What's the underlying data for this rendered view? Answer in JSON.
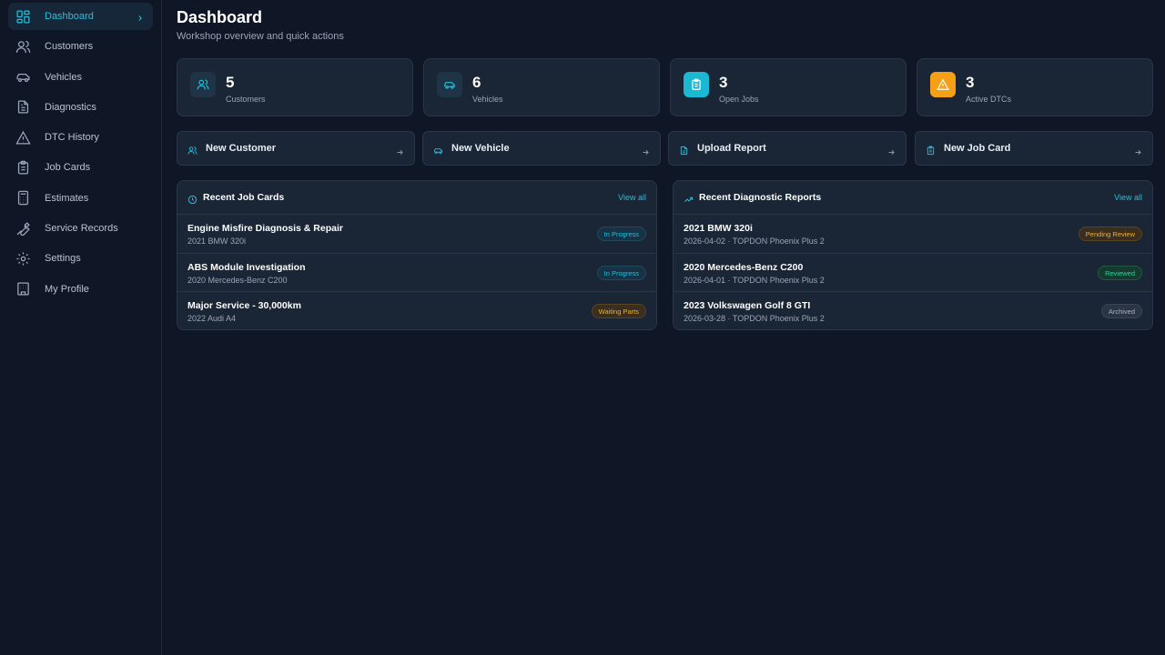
{
  "sidebar": {
    "items": [
      {
        "label": "Dashboard",
        "icon": "dashboard-icon",
        "active": true
      },
      {
        "label": "Customers",
        "icon": "users-icon"
      },
      {
        "label": "Vehicles",
        "icon": "car-icon"
      },
      {
        "label": "Diagnostics",
        "icon": "file-icon"
      },
      {
        "label": "DTC History",
        "icon": "warning-icon"
      },
      {
        "label": "Job Cards",
        "icon": "clipboard-icon"
      },
      {
        "label": "Estimates",
        "icon": "calculator-icon"
      },
      {
        "label": "Service Records",
        "icon": "wrench-icon"
      },
      {
        "label": "Settings",
        "icon": "gear-icon"
      },
      {
        "label": "My Profile",
        "icon": "building-icon"
      }
    ]
  },
  "header": {
    "title": "Dashboard",
    "subtitle": "Workshop overview and quick actions"
  },
  "stats": [
    {
      "value": "5",
      "label": "Customers",
      "icon": "users-icon"
    },
    {
      "value": "6",
      "label": "Vehicles",
      "icon": "car-icon"
    },
    {
      "value": "3",
      "label": "Open Jobs",
      "icon": "clipboard-icon"
    },
    {
      "value": "3",
      "label": "Active DTCs",
      "icon": "warning-icon"
    }
  ],
  "actions": [
    {
      "label": "New Customer",
      "icon": "user-plus-icon"
    },
    {
      "label": "New Vehicle",
      "icon": "car-icon"
    },
    {
      "label": "Upload Report",
      "icon": "file-icon"
    },
    {
      "label": "New Job Card",
      "icon": "clipboard-icon"
    }
  ],
  "job_cards": {
    "title": "Recent Job Cards",
    "link": "View all",
    "rows": [
      {
        "title": "Engine Misfire Diagnosis & Repair",
        "sub": "2021 BMW 320i",
        "status": "In Progress"
      },
      {
        "title": "ABS Module Investigation",
        "sub": "2020 Mercedes-Benz C200",
        "status": "In Progress"
      },
      {
        "title": "Major Service - 30,000km",
        "sub": "2022 Audi A4",
        "status": "Waiting Parts"
      }
    ]
  },
  "reports": {
    "title": "Recent Diagnostic Reports",
    "link": "View all",
    "rows": [
      {
        "title": "2021 BMW 320i",
        "sub": "2026-04-02 · TOPDON Phoenix Plus 2",
        "status": "Pending Review"
      },
      {
        "title": "2020 Mercedes-Benz C200",
        "sub": "2026-04-01 · TOPDON Phoenix Plus 2",
        "status": "Reviewed"
      },
      {
        "title": "2023 Volkswagen Golf 8 GTI",
        "sub": "2026-03-28 · TOPDON Phoenix Plus 2",
        "status": "Archived"
      }
    ]
  },
  "colors": {
    "accent": "#22c1dc",
    "background": "#0f1626",
    "card": "#1a2535",
    "warning": "#f5a016",
    "success": "#2fd39a"
  }
}
